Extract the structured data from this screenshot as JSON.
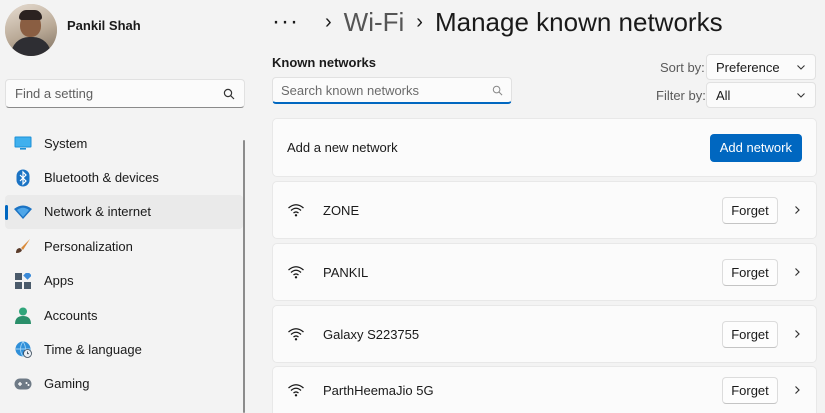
{
  "profile": {
    "name": "Pankil Shah"
  },
  "search": {
    "placeholder": "Find a setting"
  },
  "nav": [
    {
      "label": "System",
      "icon": "monitor-icon",
      "selected": false
    },
    {
      "label": "Bluetooth & devices",
      "icon": "bluetooth-icon",
      "selected": false
    },
    {
      "label": "Network & internet",
      "icon": "wifi-diamond-icon",
      "selected": true
    },
    {
      "label": "Personalization",
      "icon": "brush-icon",
      "selected": false
    },
    {
      "label": "Apps",
      "icon": "apps-icon",
      "selected": false
    },
    {
      "label": "Accounts",
      "icon": "person-icon",
      "selected": false
    },
    {
      "label": "Time & language",
      "icon": "globe-clock-icon",
      "selected": false
    },
    {
      "label": "Gaming",
      "icon": "gamepad-icon",
      "selected": false
    }
  ],
  "breadcrumb": {
    "more": "···",
    "parent": "Wi-Fi",
    "current": "Manage known networks"
  },
  "known": {
    "title": "Known networks",
    "search_placeholder": "Search known networks",
    "sort_label": "Sort by:",
    "sort_value": "Preference",
    "filter_label": "Filter by:",
    "filter_value": "All",
    "add_label": "Add a new network",
    "add_button": "Add network",
    "forget_label": "Forget",
    "networks": [
      "ZONE",
      "PANKIL",
      "Galaxy S223755",
      "ParthHeemaJio 5G"
    ]
  },
  "colors": {
    "accent": "#0067c0",
    "background": "#f3f3f3",
    "card": "#fbfbfb"
  }
}
